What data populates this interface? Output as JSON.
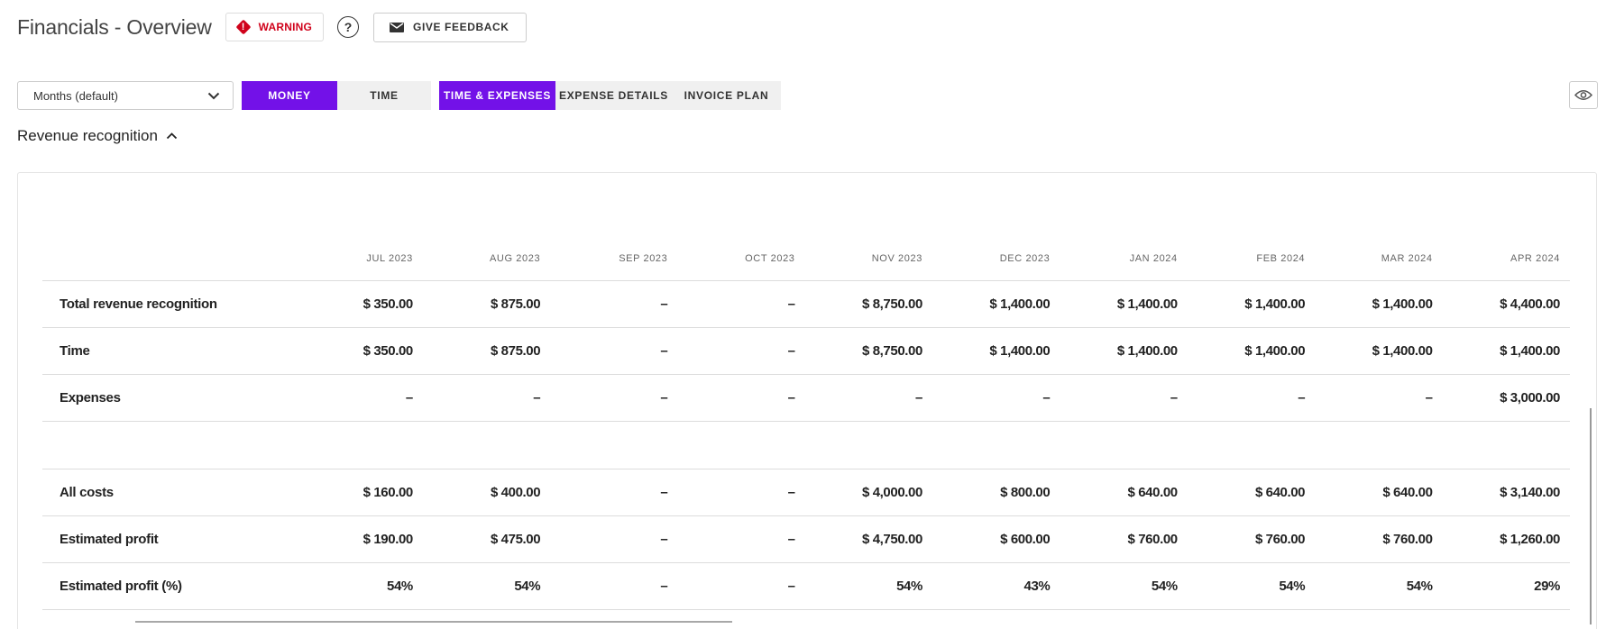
{
  "header": {
    "title": "Financials - Overview",
    "warning_icon_text": "!",
    "warning_label": "WARNING",
    "help_label": "?",
    "feedback_label": "GIVE FEEDBACK",
    "icons": {
      "warning": "warning-diamond-icon",
      "help": "question-circle-icon",
      "feedback": "mail-icon"
    }
  },
  "toolbar": {
    "period_select": "Months (default)",
    "mode_tabs": [
      {
        "label": "MONEY",
        "active": true
      },
      {
        "label": "TIME",
        "active": false
      }
    ],
    "view_tabs": [
      {
        "label": "TIME & EXPENSES",
        "active": true
      },
      {
        "label": "EXPENSE DETAILS",
        "active": false
      },
      {
        "label": "INVOICE PLAN",
        "active": false
      }
    ],
    "visibility_icon": "eye-icon"
  },
  "section": {
    "title": "Revenue recognition",
    "expanded": true
  },
  "table": {
    "columns": [
      "JUL 2023",
      "AUG 2023",
      "SEP 2023",
      "OCT 2023",
      "NOV 2023",
      "DEC 2023",
      "JAN 2024",
      "FEB 2024",
      "MAR 2024",
      "APR 2024"
    ],
    "rows": [
      {
        "label": "Total revenue recognition",
        "values": [
          "$ 350.00",
          "$ 875.00",
          "–",
          "–",
          "$ 8,750.00",
          "$ 1,400.00",
          "$ 1,400.00",
          "$ 1,400.00",
          "$ 1,400.00",
          "$ 4,400.00"
        ]
      },
      {
        "label": "Time",
        "values": [
          "$ 350.00",
          "$ 875.00",
          "–",
          "–",
          "$ 8,750.00",
          "$ 1,400.00",
          "$ 1,400.00",
          "$ 1,400.00",
          "$ 1,400.00",
          "$ 1,400.00"
        ]
      },
      {
        "label": "Expenses",
        "values": [
          "–",
          "–",
          "–",
          "–",
          "–",
          "–",
          "–",
          "–",
          "–",
          "$ 3,000.00"
        ]
      },
      {
        "label": "All costs",
        "values": [
          "$ 160.00",
          "$ 400.00",
          "–",
          "–",
          "$ 4,000.00",
          "$ 800.00",
          "$ 640.00",
          "$ 640.00",
          "$ 640.00",
          "$ 3,140.00"
        ]
      },
      {
        "label": "Estimated profit",
        "values": [
          "$ 190.00",
          "$ 475.00",
          "–",
          "–",
          "$ 4,750.00",
          "$ 600.00",
          "$ 760.00",
          "$ 760.00",
          "$ 760.00",
          "$ 1,260.00"
        ]
      },
      {
        "label": "Estimated profit (%)",
        "values": [
          "54%",
          "54%",
          "–",
          "–",
          "54%",
          "43%",
          "54%",
          "54%",
          "54%",
          "29%"
        ]
      }
    ]
  },
  "colors": {
    "accent": "#7311e8",
    "warning": "#d0021b",
    "tab_inactive_bg": "#f0f0f0",
    "border": "#dcdcdc"
  }
}
